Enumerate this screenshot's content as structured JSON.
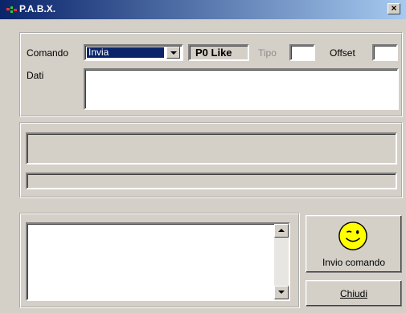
{
  "window": {
    "title": "P.A.B.X.",
    "close_label": "×"
  },
  "params": {
    "comando_label": "Comando",
    "comando_value": "Invia",
    "po_like_label": "P0 Like",
    "tipo_label": "Tipo",
    "tipo_value": "",
    "offset_label": "Offset",
    "offset_value": "",
    "dati_label": "Dati",
    "dati_value": ""
  },
  "status": {
    "line1": "",
    "line2": ""
  },
  "log": {
    "text": ""
  },
  "actions": {
    "send_label": "Invio comando",
    "close_label": "Chiudi",
    "smiley_icon": "smiley-wink-icon"
  },
  "colors": {
    "titlebar_start": "#0a246a",
    "titlebar_end": "#a6caf0",
    "face": "#d4d0c8",
    "smiley": "#ffff00"
  }
}
